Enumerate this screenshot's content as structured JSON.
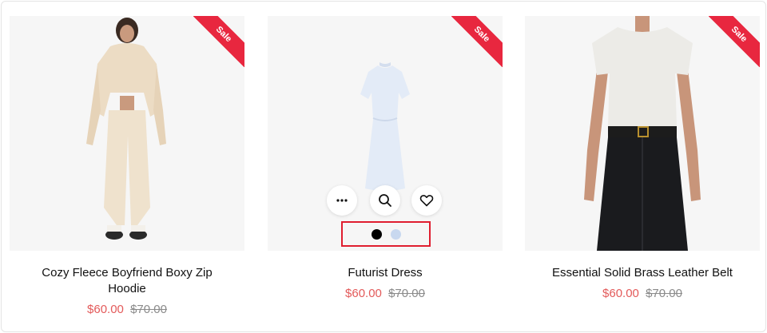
{
  "products": [
    {
      "title": "Cozy Fleece Boyfriend Boxy Zip Hoodie",
      "badge": "Sale",
      "price": "$60.00",
      "compare_price": "$70.00"
    },
    {
      "title": "Futurist Dress",
      "badge": "Sale",
      "price": "$60.00",
      "compare_price": "$70.00",
      "actions": [
        "more-icon",
        "search-icon",
        "heart-icon"
      ],
      "swatches": [
        "#000000",
        "#c8d8ef"
      ]
    },
    {
      "title": "Essential Solid Brass Leather Belt",
      "badge": "Sale",
      "price": "$60.00",
      "compare_price": "$70.00"
    }
  ],
  "colors": {
    "sale_ribbon": "#e8273f",
    "price": "#e35a5a",
    "compare_price": "#8b8b8b",
    "highlight_box": "#e01e2f"
  }
}
